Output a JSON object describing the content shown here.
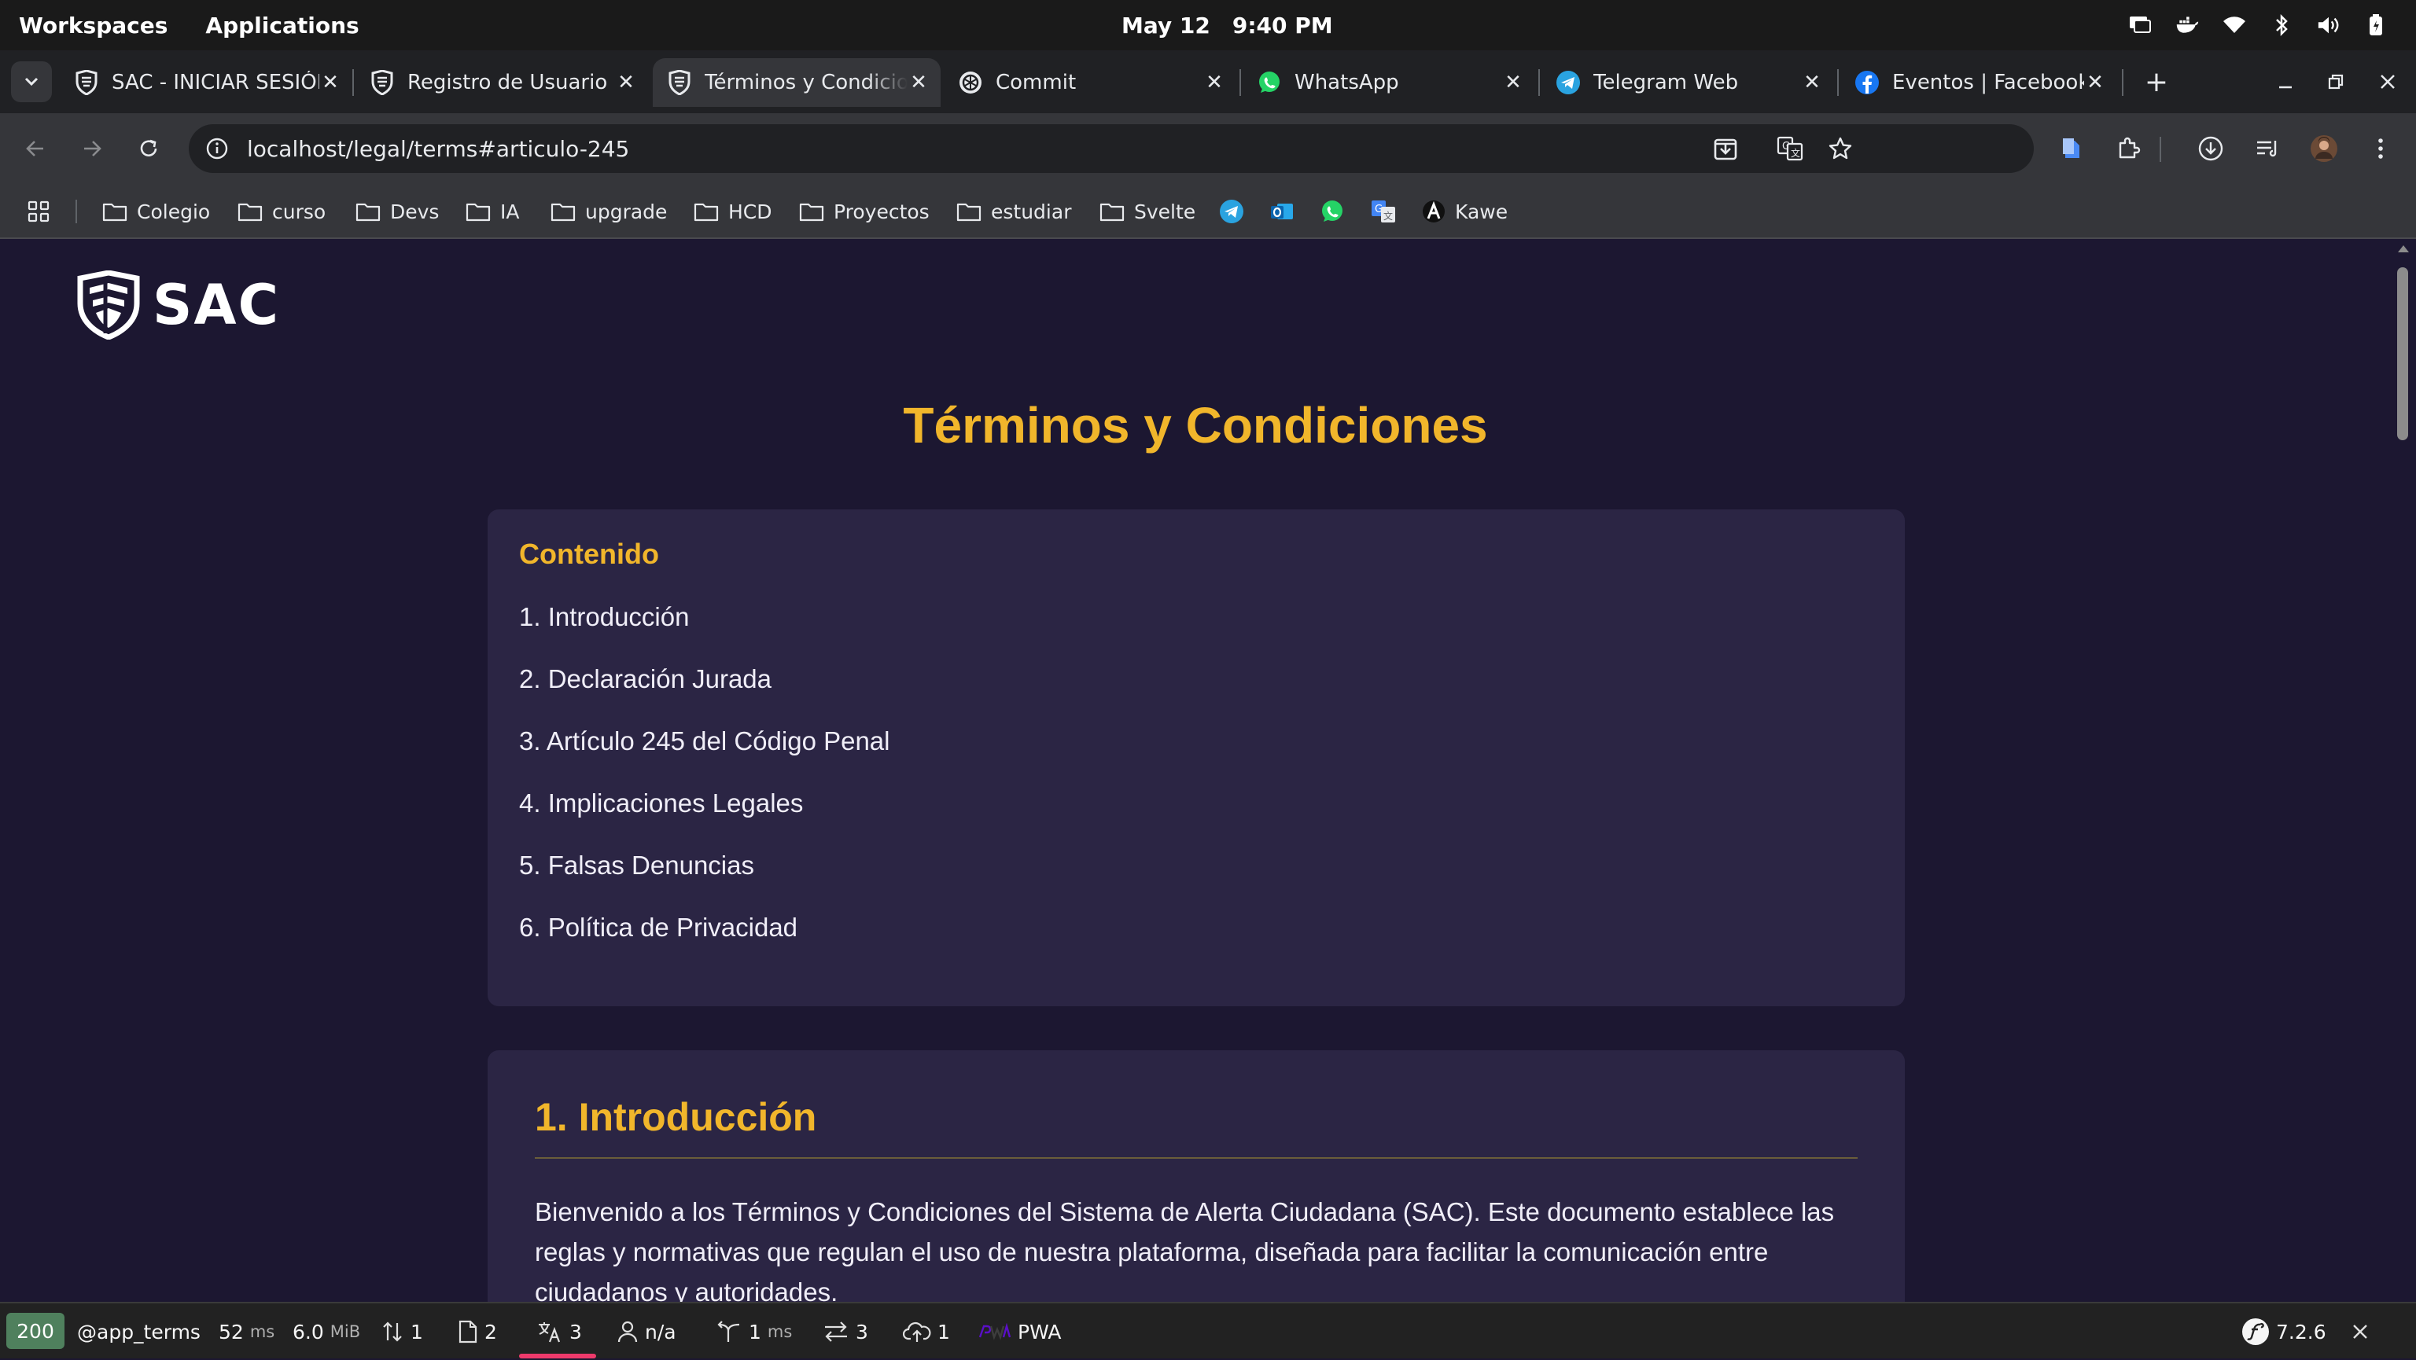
{
  "system_bar": {
    "workspaces": "Workspaces",
    "applications": "Applications",
    "clock_date": "May 12",
    "clock_time": "9:40 PM"
  },
  "tabs": [
    {
      "title": "SAC - INICIAR SESIÓN",
      "icon": "sac-shield-icon",
      "active": false
    },
    {
      "title": "Registro de Usuario",
      "icon": "sac-shield-icon",
      "active": false
    },
    {
      "title": "Términos y Condiciones",
      "icon": "sac-shield-icon",
      "active": true
    },
    {
      "title": "Commit",
      "icon": "openai-icon",
      "active": false
    },
    {
      "title": "WhatsApp",
      "icon": "whatsapp-icon",
      "active": false
    },
    {
      "title": "Telegram Web",
      "icon": "telegram-icon",
      "active": false
    },
    {
      "title": "Eventos | Facebook",
      "icon": "facebook-icon",
      "active": false
    }
  ],
  "address_bar": {
    "url": "localhost/legal/terms#articulo-245"
  },
  "bookmarks": [
    {
      "label": "Colegio",
      "icon": "folder-icon"
    },
    {
      "label": "curso",
      "icon": "folder-icon"
    },
    {
      "label": "Devs",
      "icon": "folder-icon"
    },
    {
      "label": "IA",
      "icon": "folder-icon"
    },
    {
      "label": "upgrade",
      "icon": "folder-icon"
    },
    {
      "label": "HCD",
      "icon": "folder-icon"
    },
    {
      "label": "Proyectos",
      "icon": "folder-icon"
    },
    {
      "label": "estudiar",
      "icon": "folder-icon"
    },
    {
      "label": "Svelte",
      "icon": "folder-icon"
    },
    {
      "label": "Kawe",
      "icon": "kawe-icon"
    }
  ],
  "page": {
    "logo_text": "SAC",
    "title": "Términos y Condiciones",
    "toc": {
      "heading": "Contenido",
      "items": [
        "1. Introducción",
        "2. Declaración Jurada",
        "3. Artículo 245 del Código Penal",
        "4. Implicaciones Legales",
        "5. Falsas Denuncias",
        "6. Política de Privacidad"
      ]
    },
    "section1": {
      "heading": "1. Introducción",
      "paragraph": "Bienvenido a los Términos y Condiciones del Sistema de Alerta Ciudadana (SAC). Este documento establece las reglas y normativas que regulan el uso de nuestra plataforma, diseñada para facilitar la comunicación entre ciudadanos y autoridades."
    }
  },
  "debug_bar": {
    "status": "200",
    "route": "@app_terms",
    "time_value": "52",
    "time_unit": "ms",
    "memory_value": "6.0",
    "memory_unit": "MiB",
    "requests": "1",
    "templates": "2",
    "translations": "3",
    "user": "n/a",
    "events_value": "1",
    "events_unit": "ms",
    "forms": "3",
    "uploads": "1",
    "pwa": "PWA",
    "symfony_version": "7.2.6"
  },
  "colors": {
    "accent_gold": "#f1b62b",
    "page_bg": "#1c1731",
    "card_bg": "#2b2544",
    "status_ok": "#4f805d"
  }
}
